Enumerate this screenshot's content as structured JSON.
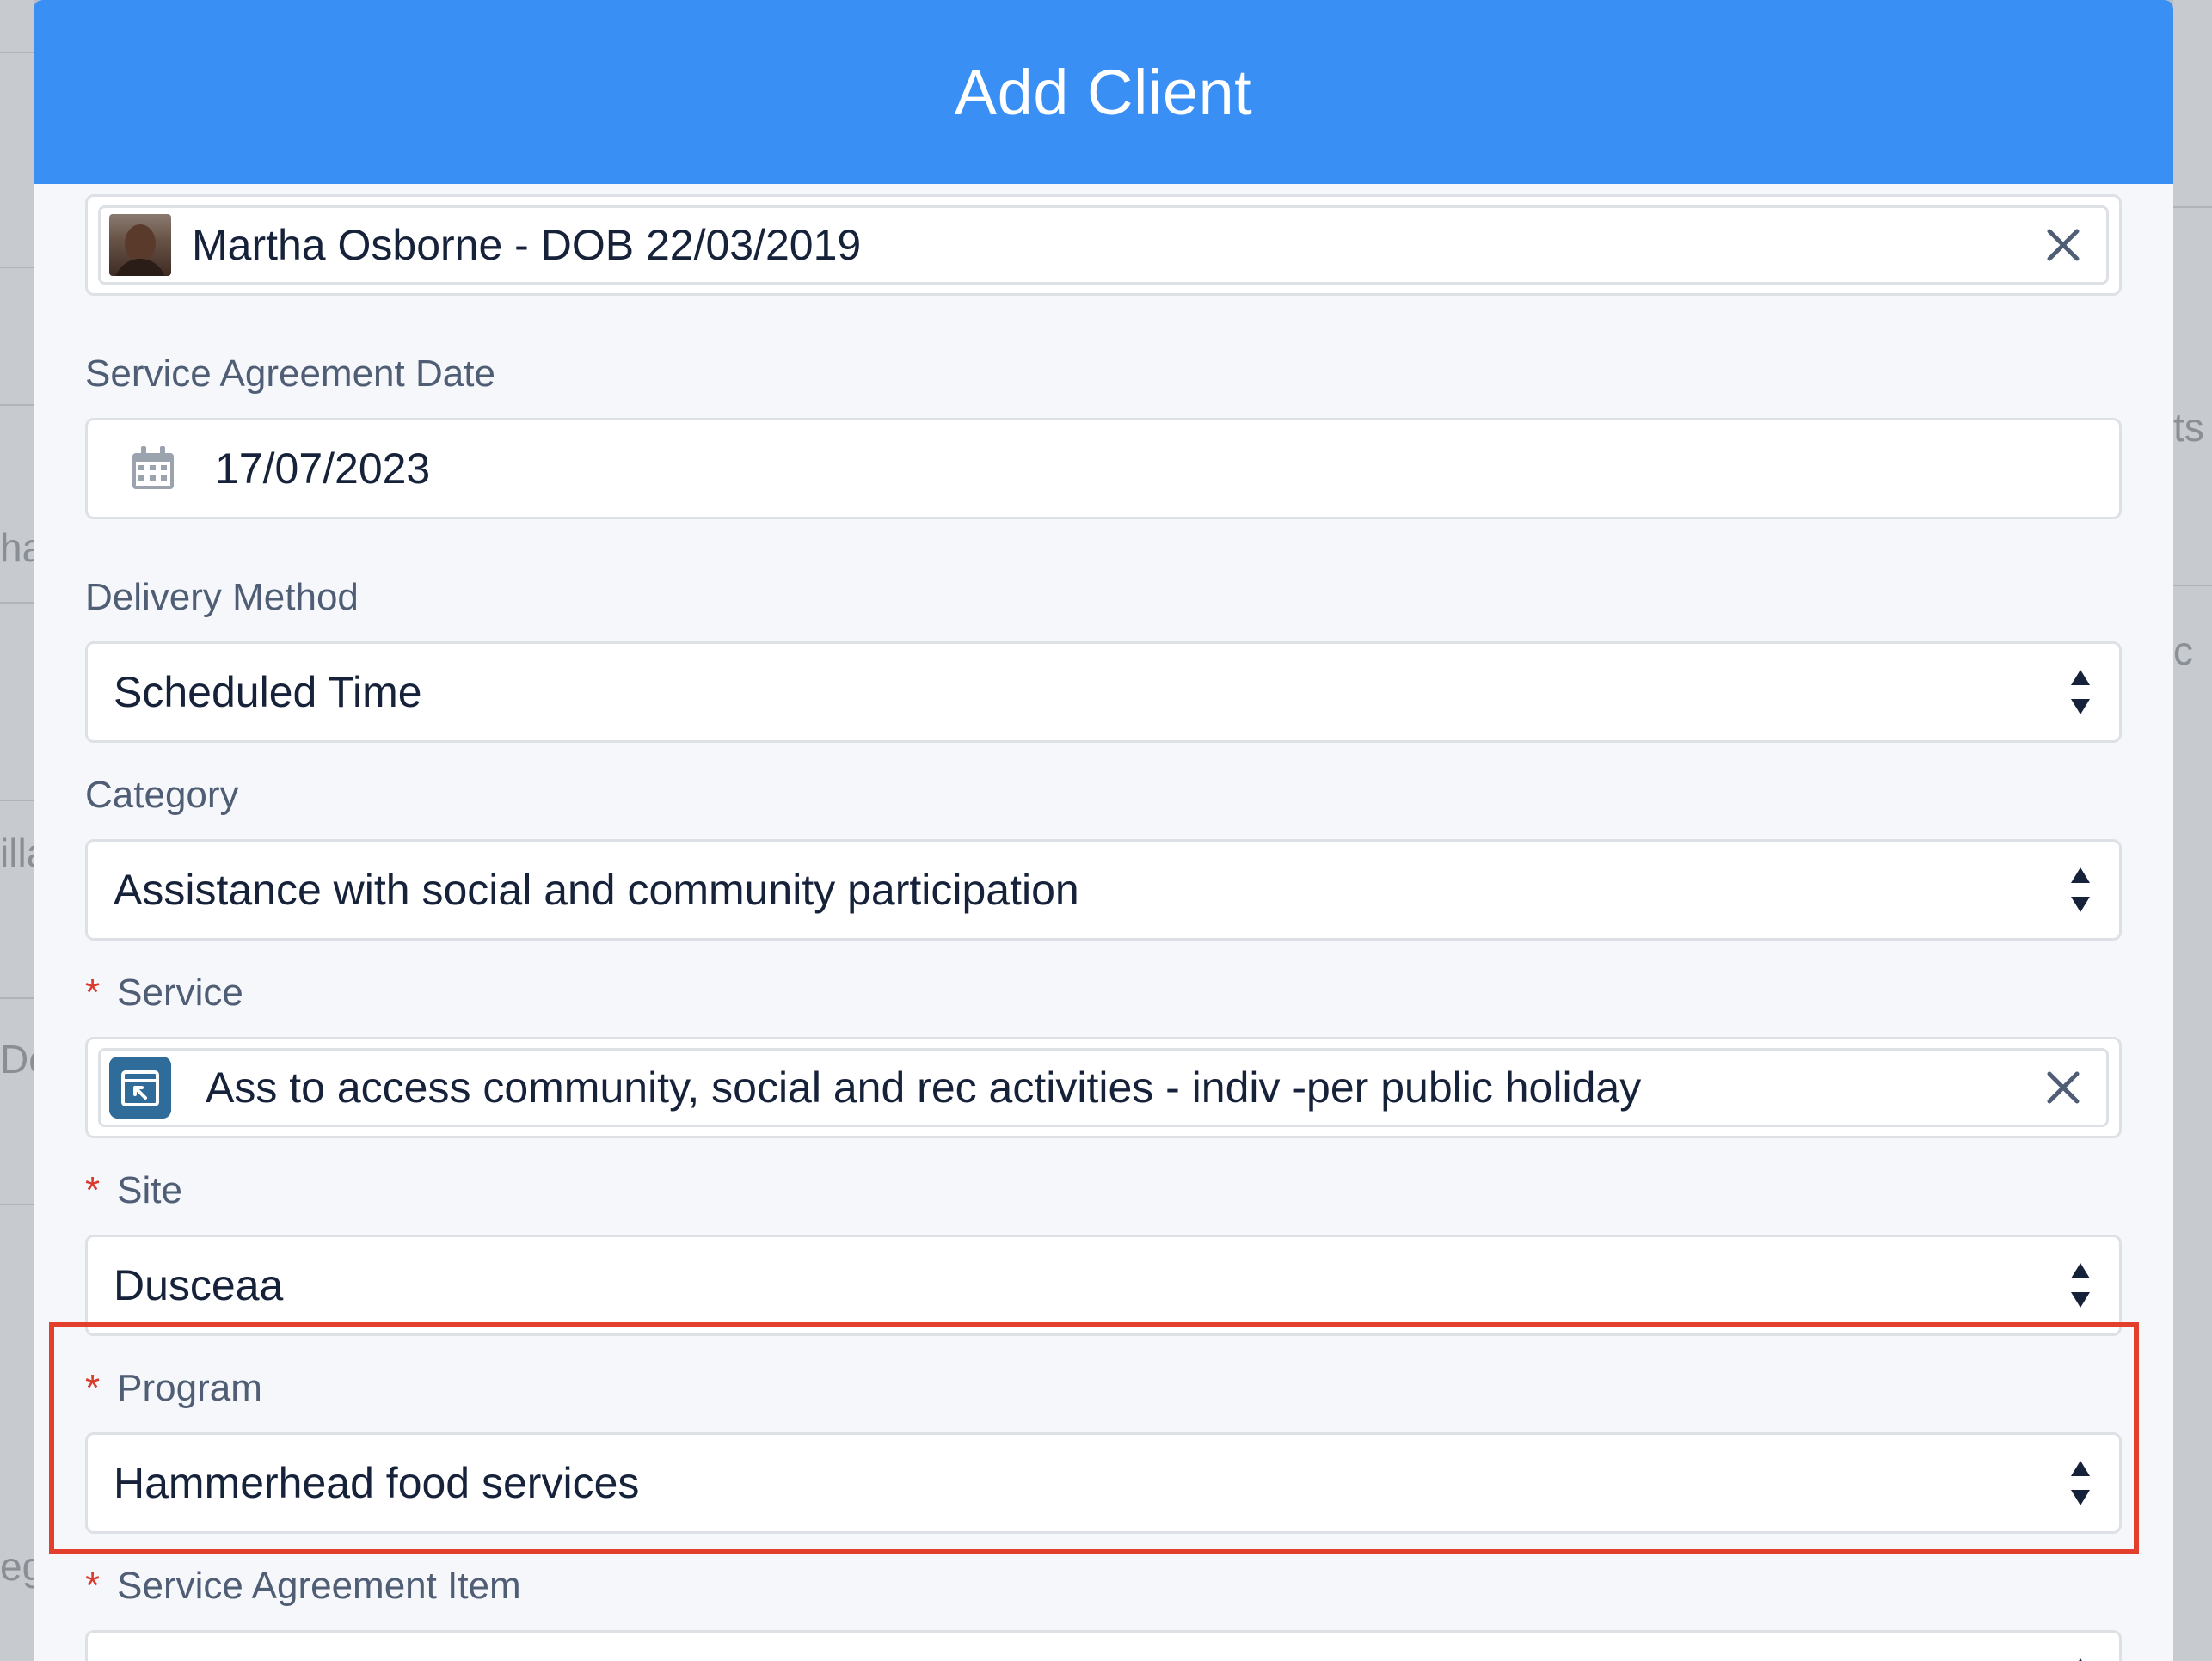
{
  "modal": {
    "title": "Add Client"
  },
  "client": {
    "value": "Martha Osborne - DOB 22/03/2019",
    "avatar_icon": "client-avatar",
    "clear_icon": "close-icon"
  },
  "service_agreement_date": {
    "label": "Service Agreement Date",
    "value": "17/07/2023",
    "icon": "calendar-icon"
  },
  "delivery_method": {
    "label": "Delivery Method",
    "value": "Scheduled Time"
  },
  "category": {
    "label": "Category",
    "value": "Assistance with social and community participation"
  },
  "service": {
    "required_mark": "*",
    "label": "Service",
    "value": "Ass to access community, social and rec activities - indiv -per public holiday",
    "icon": "service-icon",
    "clear_icon": "close-icon"
  },
  "site": {
    "required_mark": "*",
    "label": "Site",
    "value": "Dusceaa"
  },
  "program": {
    "required_mark": "*",
    "label": "Program",
    "value": "Hammerhead food services"
  },
  "service_agreement_item": {
    "required_mark": "*",
    "label": "Service Agreement Item"
  },
  "background": {
    "fragments": [
      "ts",
      "ha",
      "c",
      "illa",
      "De",
      "eg"
    ]
  },
  "colors": {
    "header": "#3a8ff4",
    "highlight": "#e2402c",
    "required": "#d93a2c"
  }
}
